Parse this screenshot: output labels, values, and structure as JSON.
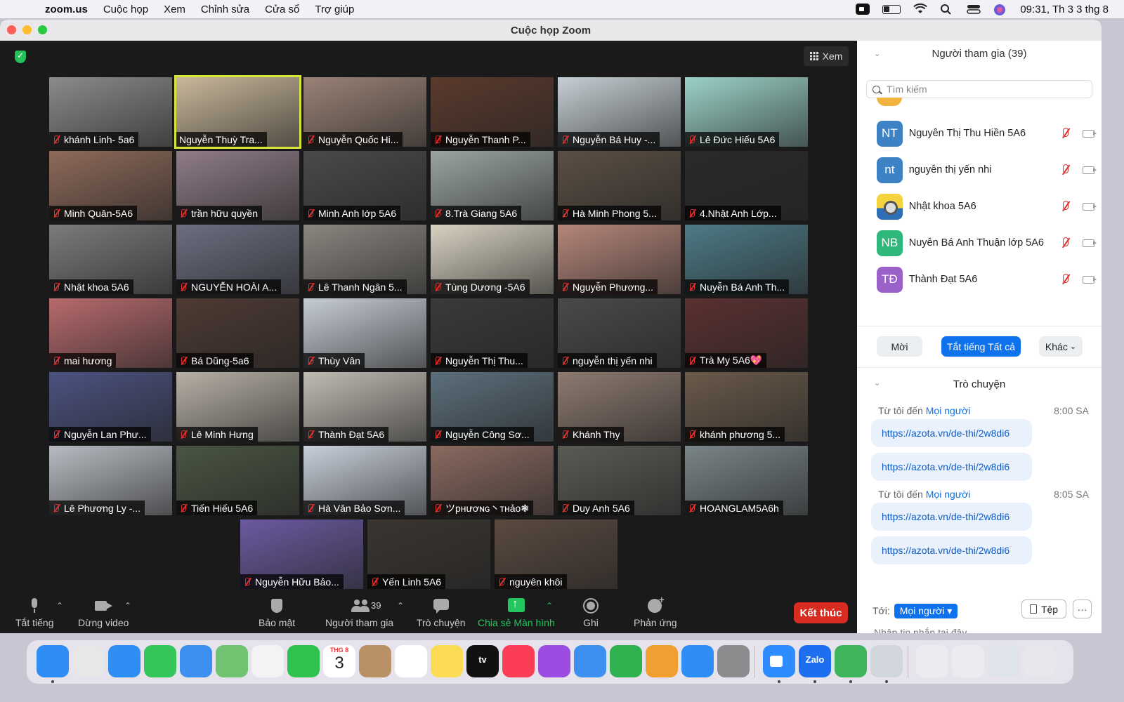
{
  "menubar": {
    "app_name": "zoom.us",
    "items": [
      "Cuộc họp",
      "Xem",
      "Chỉnh sửa",
      "Cửa sổ",
      "Trợ giúp"
    ],
    "clock": "09:31, Th 3 3 thg 8"
  },
  "window": {
    "title": "Cuộc họp Zoom"
  },
  "view_button": {
    "label": "Xem"
  },
  "participants_tiles": [
    {
      "name": "khánh Linh- 5a6",
      "bg": "#8c8a8a",
      "muted": true
    },
    {
      "name": "Nguyễn Thuỳ Tra...",
      "bg": "#c9b89b",
      "muted": false,
      "active": true
    },
    {
      "name": "Nguyễn Quốc Hi...",
      "bg": "#9a8276",
      "muted": true
    },
    {
      "name": "Nguyễn Thanh P...",
      "bg": "#5b3a2c",
      "muted": true
    },
    {
      "name": "Nguyễn Bá Huy -...",
      "bg": "#c6cfd4",
      "muted": true
    },
    {
      "name": "Lê Đức Hiếu 5A6",
      "bg": "#9bd2c8",
      "muted": true
    },
    {
      "name": "Minh Quân-5A6",
      "bg": "#8e6a5a",
      "muted": true
    },
    {
      "name": "trần hữu quyền",
      "bg": "#8f7c87",
      "muted": true
    },
    {
      "name": "Minh Anh lớp 5A6",
      "bg": "#4a4a48",
      "muted": true
    },
    {
      "name": "8.Trà Giang 5A6",
      "bg": "#9aa5a0",
      "muted": true
    },
    {
      "name": "Hà Minh Phong 5...",
      "bg": "#5b4f44",
      "muted": true
    },
    {
      "name": "4.Nhật Anh Lớp...",
      "bg": "#2a2a2a",
      "muted": true
    },
    {
      "name": "Nhật khoa 5A6",
      "bg": "#7b7b7b",
      "muted": true
    },
    {
      "name": "NGUYỄN HOÀI A...",
      "bg": "#6b6f80",
      "muted": true
    },
    {
      "name": "Lê Thanh Ngân 5...",
      "bg": "#8a8680",
      "muted": true
    },
    {
      "name": "Tùng Dương -5A6",
      "bg": "#d8d2c2",
      "muted": true
    },
    {
      "name": "Nguyễn Phương...",
      "bg": "#b5867a",
      "muted": true
    },
    {
      "name": "Nuyễn Bá Anh Th...",
      "bg": "#4d7a86",
      "muted": true
    },
    {
      "name": "mai hương",
      "bg": "#b76a6d",
      "muted": true
    },
    {
      "name": "Bá Dũng-5a6",
      "bg": "#4e3a33",
      "muted": true
    },
    {
      "name": "Thùy Vân",
      "bg": "#c7cdd6",
      "muted": true
    },
    {
      "name": "Nguyễn Thị Thu...",
      "bg": "#3a3a3a",
      "muted": true
    },
    {
      "name": "nguyễn thị yến nhi",
      "bg": "#4a4a4a",
      "muted": true
    },
    {
      "name": "Trà My 5A6💖",
      "bg": "#5a3030",
      "muted": true
    },
    {
      "name": "Nguyễn Lan Phư...",
      "bg": "#4b5280",
      "muted": true
    },
    {
      "name": "Lê Minh Hưng",
      "bg": "#b7b0a6",
      "muted": true
    },
    {
      "name": "Thành Đạt 5A6",
      "bg": "#c1bcb4",
      "muted": true
    },
    {
      "name": "Nguyễn Công Sơ...",
      "bg": "#5c6f7c",
      "muted": true
    },
    {
      "name": "Khánh Thy",
      "bg": "#8d7a70",
      "muted": true
    },
    {
      "name": "khánh phương 5...",
      "bg": "#6a5a4a",
      "muted": true
    },
    {
      "name": "Lê Phương Ly -...",
      "bg": "#b8bcc2",
      "muted": true
    },
    {
      "name": "Tiến Hiếu 5A6",
      "bg": "#4a5542",
      "muted": true
    },
    {
      "name": "Hà Văn Bảo Sơn...",
      "bg": "#c9d0db",
      "muted": true
    },
    {
      "name": "ツpнươɴɢ丶тнảo❃",
      "bg": "#8a6a60",
      "muted": true
    },
    {
      "name": "Duy Anh 5A6",
      "bg": "#5a5a55",
      "muted": true
    },
    {
      "name": "HOANGLAM5A6h",
      "bg": "#7a8588",
      "muted": true
    },
    {
      "name": "Nguyễn Hữu Bảo...",
      "bg": "#6b5aa0",
      "muted": true
    },
    {
      "name": "Yến Linh 5A6",
      "bg": "#3a3530",
      "muted": true
    },
    {
      "name": "nguyên khôi",
      "bg": "#5a4a40",
      "muted": true
    }
  ],
  "toolbar": {
    "mute": "Tắt tiếng",
    "stop_video": "Dừng video",
    "security": "Bảo mật",
    "participants": "Người tham gia",
    "participant_count": "39",
    "chat": "Trò chuyện",
    "share_screen": "Chia sẻ Màn hình",
    "record": "Ghi",
    "reactions": "Phản ứng",
    "end": "Kết thúc"
  },
  "panel": {
    "participants_title": "Người tham gia (39)",
    "search_placeholder": "Tìm kiếm",
    "list": [
      {
        "initials": "NT",
        "name": "Nguyễn Thị Thu Hiền 5A6",
        "color": "#3c82c4"
      },
      {
        "initials": "nt",
        "name": "nguyễn thị yến nhi",
        "color": "#3c82c4"
      },
      {
        "initials": "",
        "name": "Nhật khoa 5A6",
        "color": "minion"
      },
      {
        "initials": "NB",
        "name": "Nuyễn Bá Anh Thuận lớp 5A6",
        "color": "#2fb87a"
      },
      {
        "initials": "TĐ",
        "name": "Thành Đạt 5A6",
        "color": "#9a62c8"
      }
    ],
    "invite": "Mời",
    "mute_all": "Tắt tiếng Tất cả",
    "more": "Khác",
    "chat_title": "Trò chuyện",
    "messages": [
      {
        "from": "Từ tôi đến ",
        "to": "Mọi người",
        "time": "8:00 SA",
        "links": [
          "https://azota.vn/de-thi/2w8di6",
          "https://azota.vn/de-thi/2w8di6"
        ]
      },
      {
        "from": "Từ tôi đến ",
        "to": "Mọi người",
        "time": "8:05 SA",
        "links": [
          "https://azota.vn/de-thi/2w8di6",
          "https://azota.vn/de-thi/2w8di6"
        ]
      }
    ],
    "to_label": "Tới:",
    "to_value": "Mọi người ▾",
    "file_button": "Tệp",
    "input_placeholder": "Nhập tin nhắn tại đây..."
  },
  "dock": {
    "calendar_month": "THG 8",
    "calendar_day": "3",
    "tv_label": "tv",
    "zalo_label": "Zalo",
    "apps": [
      {
        "name": "finder",
        "color": "#2e8ef5"
      },
      {
        "name": "launchpad",
        "color": "#e7e7ea"
      },
      {
        "name": "safari",
        "color": "#2f8ef3"
      },
      {
        "name": "messages",
        "color": "#35c659"
      },
      {
        "name": "mail",
        "color": "#3d8ff0"
      },
      {
        "name": "maps",
        "color": "#6fc371"
      },
      {
        "name": "photos",
        "color": "#f3f3f3"
      },
      {
        "name": "facetime",
        "color": "#2fc24f"
      },
      {
        "name": "calendar",
        "color": "#ffffff"
      },
      {
        "name": "contacts",
        "color": "#b89266"
      },
      {
        "name": "reminders",
        "color": "#ffffff"
      },
      {
        "name": "notes",
        "color": "#fbdb54"
      },
      {
        "name": "apple-tv",
        "color": "#111111"
      },
      {
        "name": "music",
        "color": "#fb3d55"
      },
      {
        "name": "podcasts",
        "color": "#9a4de0"
      },
      {
        "name": "keynote",
        "color": "#3d8ff0"
      },
      {
        "name": "numbers",
        "color": "#2fb24f"
      },
      {
        "name": "pages",
        "color": "#f0a030"
      },
      {
        "name": "app-store",
        "color": "#2e8ef5"
      },
      {
        "name": "system-preferences",
        "color": "#8c8c8e"
      },
      {
        "name": "zoom",
        "color": "#2d8cff"
      },
      {
        "name": "zalo",
        "color": "#1e6ff0"
      },
      {
        "name": "chrome-like",
        "color": "#3fb45a"
      },
      {
        "name": "preview",
        "color": "#d0d6dc"
      },
      {
        "name": "recent-doc-1",
        "color": "#ecebf0"
      },
      {
        "name": "recent-doc-2",
        "color": "#ecebf0"
      },
      {
        "name": "recent-doc-3",
        "color": "#dfe3ea"
      },
      {
        "name": "trash",
        "color": "#e8e8ec"
      }
    ]
  }
}
